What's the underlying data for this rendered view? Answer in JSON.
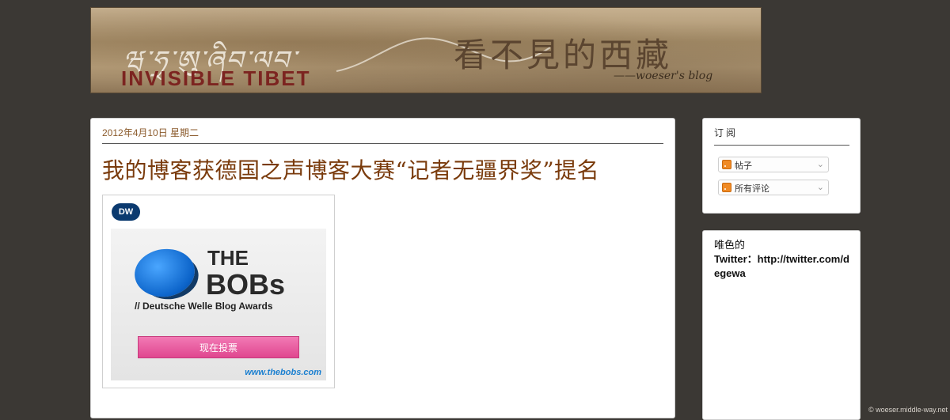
{
  "banner": {
    "tibetan_text": "ཝ་ཧྲ་ཨུ་ཞིབ་ལབ་",
    "title": "INVISIBLE TIBET",
    "cn_title": "看不見的西藏",
    "subtitle": "——woeser's blog"
  },
  "post": {
    "date": "2012年4月10日 星期二",
    "title": "我的博客获德国之声博客大赛“记者无疆界奖”提名",
    "award": {
      "dw_logo": "DW",
      "the": "THE",
      "bobs": "BOBs",
      "subtitle": "// Deutsche Welle Blog Awards",
      "vote_label": "现在投票",
      "url": "www.thebobs.com"
    }
  },
  "sidebar": {
    "subscribe_title": "订阅",
    "feeds": [
      {
        "label": "帖子",
        "icon": "rss-icon"
      },
      {
        "label": "所有评论",
        "icon": "rss-icon"
      }
    ],
    "twitter_label": "唯色的",
    "twitter_link": "Twitter：http://twitter.com/degewa"
  },
  "footer": {
    "credit": "© woeser.middle-way.net"
  },
  "colors": {
    "background": "#3b3834",
    "title": "#7a3b0c",
    "vote_button": "#e0468f"
  }
}
